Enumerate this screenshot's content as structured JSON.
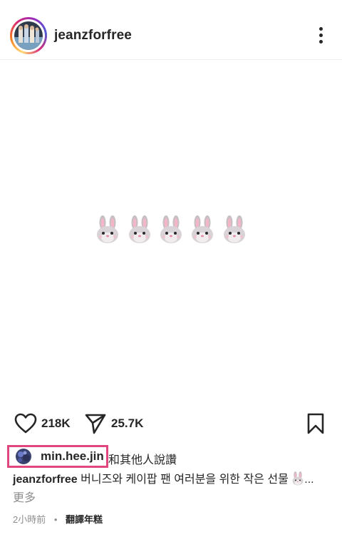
{
  "header": {
    "username": "jeanzforfree"
  },
  "post": {
    "emoji_count": 5
  },
  "actions": {
    "likes_count": "218K",
    "shares_count": "25.7K"
  },
  "likes": {
    "liker_name": "min.hee.jin",
    "liked_text": "和其他人說讚"
  },
  "caption": {
    "username": "jeanzforfree",
    "text": "버니즈와 케이팝 팬 여러분을 위한 작은 선물",
    "ellipsis": "...",
    "more_label": "更多"
  },
  "meta": {
    "time": "2小時前",
    "separator": "•",
    "translate_label": "翻譯年糕"
  },
  "colors": {
    "highlight_box": "#e0477e",
    "text_primary": "#262626",
    "text_secondary": "#8e8e8e"
  }
}
